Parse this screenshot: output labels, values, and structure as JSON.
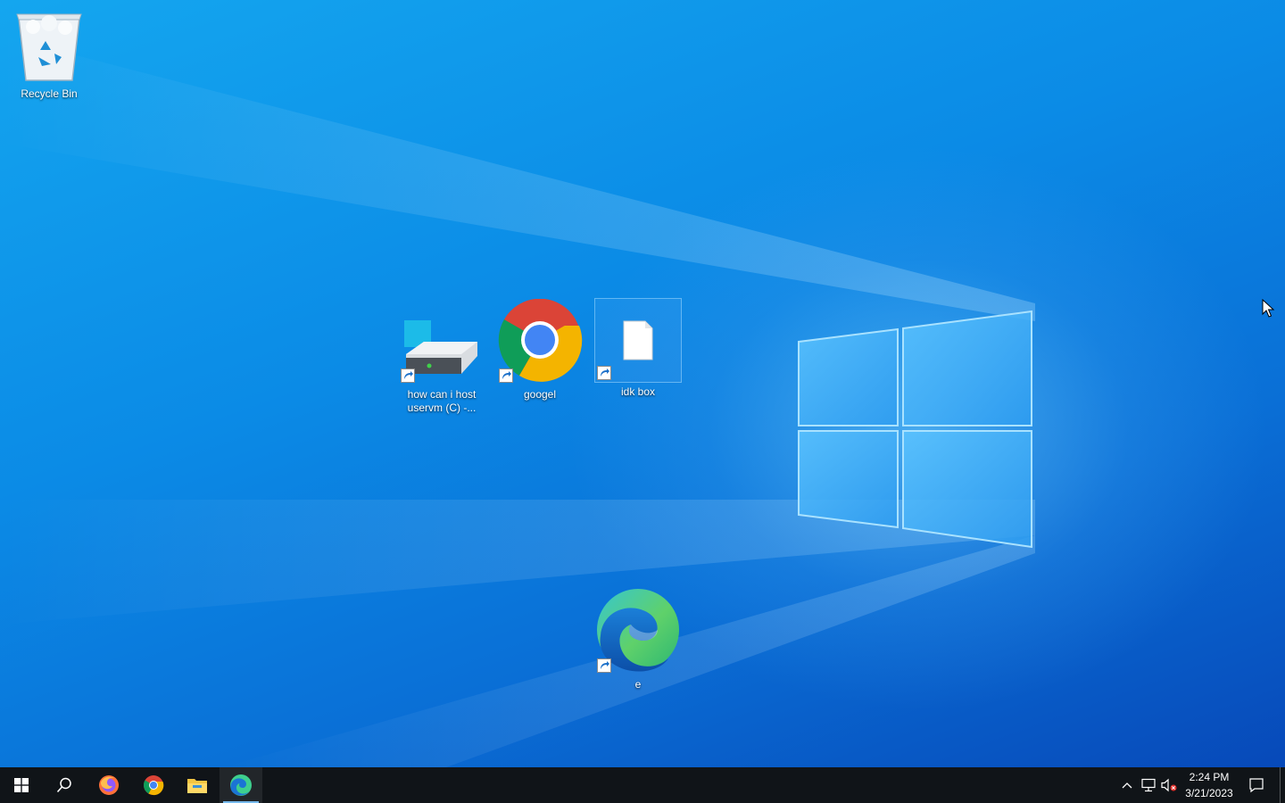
{
  "desktop": {
    "icons": [
      {
        "label": "Recycle Bin",
        "icon": "recycle-bin-icon"
      },
      {
        "label": "how can i host uservm (C) -...",
        "icon": "drive-shortcut-icon"
      },
      {
        "label": "googel",
        "icon": "chrome-shortcut-icon"
      },
      {
        "label": "idk box",
        "icon": "file-shortcut-icon"
      },
      {
        "label": "e",
        "icon": "edge-shortcut-icon"
      }
    ]
  },
  "taskbar": {
    "apps": [
      {
        "name": "start",
        "icon": "windows-start-icon"
      },
      {
        "name": "search",
        "icon": "search-icon"
      },
      {
        "name": "firefox",
        "icon": "firefox-icon"
      },
      {
        "name": "chrome",
        "icon": "chrome-icon"
      },
      {
        "name": "file-explorer",
        "icon": "folder-icon"
      },
      {
        "name": "edge",
        "icon": "edge-icon",
        "active": true
      }
    ],
    "tray": {
      "time": "2:24 PM",
      "date": "3/21/2023"
    }
  },
  "colors": {
    "taskbar_bg": "#101418",
    "accent": "#76b9ed",
    "desktop_top": "#14a6ef",
    "desktop_bottom": "#0749b9"
  }
}
